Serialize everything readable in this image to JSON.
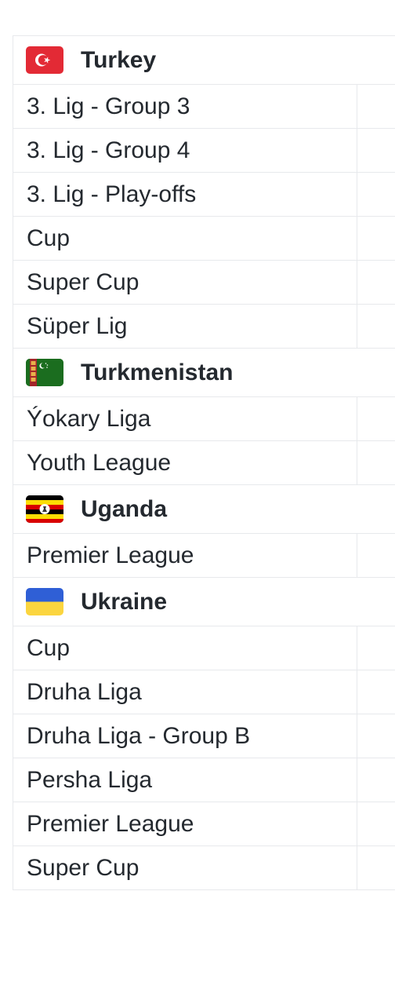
{
  "groups": [
    {
      "country": "Turkey",
      "flag_icon": "turkey-flag-icon",
      "leagues": [
        "3. Lig - Group 3",
        "3. Lig - Group 4",
        "3. Lig - Play-offs",
        "Cup",
        "Super Cup",
        "Süper Lig"
      ]
    },
    {
      "country": "Turkmenistan",
      "flag_icon": "turkmenistan-flag-icon",
      "leagues": [
        "Ýokary Liga",
        "Youth League"
      ]
    },
    {
      "country": "Uganda",
      "flag_icon": "uganda-flag-icon",
      "leagues": [
        "Premier League"
      ]
    },
    {
      "country": "Ukraine",
      "flag_icon": "ukraine-flag-icon",
      "leagues": [
        "Cup",
        "Druha Liga",
        "Druha Liga - Group B",
        "Persha Liga",
        "Premier League",
        "Super Cup"
      ]
    }
  ],
  "colors": {
    "border": "#e7e9ec",
    "text": "#24292f",
    "turkey_red": "#e32a35",
    "turkmenistan_green": "#1b6d1f",
    "uganda_yellow": "#fcdc04",
    "uganda_red": "#d90000",
    "ukraine_blue": "#2f5fd6",
    "ukraine_yellow": "#fbd53f"
  }
}
